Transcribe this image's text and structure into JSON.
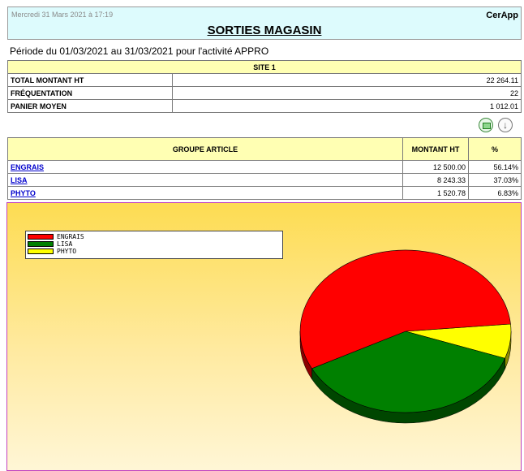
{
  "header": {
    "date": "Mercredi 31 Mars 2021 à 17:19",
    "app": "CerApp",
    "title": "SORTIES MAGASIN"
  },
  "period": "Période du 01/03/2021 au 31/03/2021 pour l'activité APPRO",
  "site": {
    "title": "SITE 1",
    "rows": [
      {
        "label": "TOTAL MONTANT HT",
        "value": "22 264.11"
      },
      {
        "label": "FRÉQUENTATION",
        "value": "22"
      },
      {
        "label": "PANIER MOYEN",
        "value": "1 012.01"
      }
    ]
  },
  "icons": [
    "excel-export-icon",
    "download-arrow-icon"
  ],
  "groups": {
    "headers": {
      "group": "GROUPE ARTICLE",
      "amount": "MONTANT HT",
      "pct": "%"
    },
    "rows": [
      {
        "name": "ENGRAIS",
        "amount": "12 500.00",
        "pct": "56.14%"
      },
      {
        "name": "LISA",
        "amount": "8 243.33",
        "pct": "37.03%"
      },
      {
        "name": "PHYTO",
        "amount": "1 520.78",
        "pct": "6.83%"
      }
    ]
  },
  "chart_data": {
    "type": "pie",
    "categories": [
      "ENGRAIS",
      "LISA",
      "PHYTO"
    ],
    "values": [
      56.14,
      37.03,
      6.83
    ],
    "colors": [
      "#ff0000",
      "#008000",
      "#ffff00"
    ],
    "title": "",
    "legend": "top-left"
  }
}
